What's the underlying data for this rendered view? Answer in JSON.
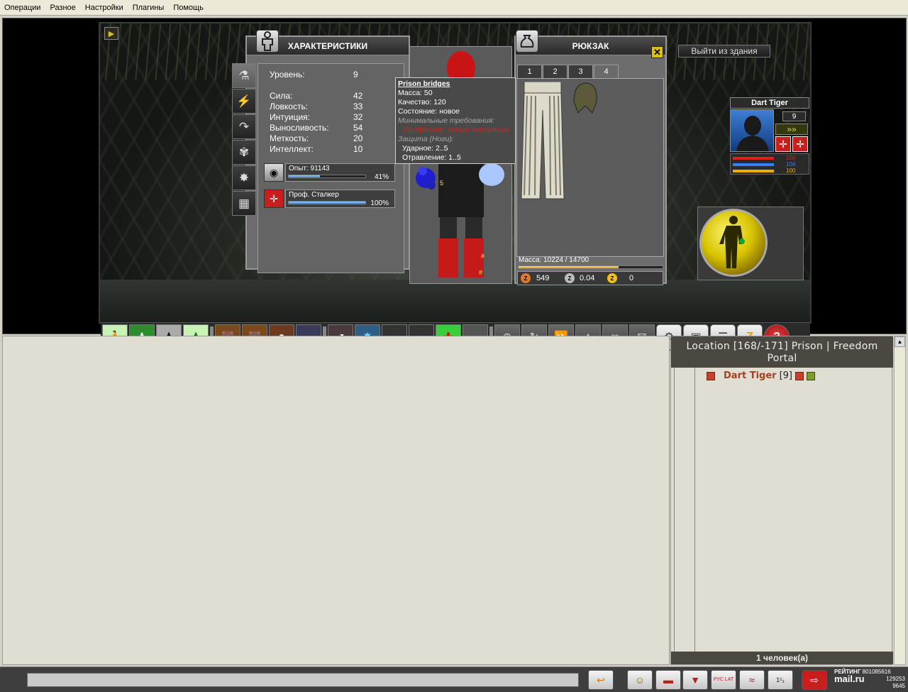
{
  "menu": [
    "Операции",
    "Разное",
    "Настройки",
    "Плагины",
    "Помощь"
  ],
  "scene": {
    "exit_button": "Выйти из здания"
  },
  "stats_panel": {
    "title": "ХАРАКТЕРИСТИКИ",
    "level_label": "Уровень:",
    "level_value": "9",
    "stats": [
      {
        "label": "Сила:",
        "value": "42"
      },
      {
        "label": "Ловкость:",
        "value": "33"
      },
      {
        "label": "Интуиция:",
        "value": "32"
      },
      {
        "label": "Выносливость:",
        "value": "54"
      },
      {
        "label": "Меткость:",
        "value": "20"
      },
      {
        "label": "Интеллект:",
        "value": "10"
      }
    ],
    "exp_label": "Опыт: 91143",
    "exp_pct": "41%",
    "exp_fraction": 0.41,
    "prof_label": "Проф. Сталкер",
    "prof_pct": "100%",
    "prof_fraction": 1.0
  },
  "tooltip": {
    "title": "Prison bridges",
    "mass": "Масса: 50",
    "quality": "Качество: 120",
    "state": "Состояние: новое",
    "req_header": "Минимальные требования:",
    "req_prof": "Профессия: только Каторжник",
    "defense_header": "Защита (Ноги):",
    "def_impact": "Ударное: 2..5",
    "def_poison": "Отравление: 1..5"
  },
  "backpack": {
    "title": "РЮКЗАК",
    "tabs": [
      "1",
      "2",
      "3",
      "4"
    ],
    "active_tab": 3,
    "mass_label": "Масса: 10224 / 14700",
    "mass_fraction": 0.6955,
    "money1": "549",
    "money2": "0.04",
    "money3": "0"
  },
  "figure": {
    "mark_5": "5",
    "mark_hash1": "#",
    "mark_hash2": "#"
  },
  "char_card": {
    "name": "Dart Tiger",
    "level": "9",
    "hp1": "150",
    "hp2": "104",
    "hp3": "100"
  },
  "location": {
    "header": "Location [168/-171] Prison | Freedom Portal",
    "player_name": "Dart Tiger",
    "player_level": "[9]",
    "footer": "1 человек(а)"
  },
  "bottom": {
    "rating_label": "РЕЙТИНГ",
    "rating_num1": "801085616",
    "rating_num2": "129253",
    "rating_num3": "9645",
    "mailru": "mail.ru",
    "translit": "РУС LAT",
    "numbers_icon": "1²₃"
  },
  "colors": {
    "accent_yellow": "#e0c000",
    "player_name": "#a8401c",
    "panel_header": "#4a4840"
  }
}
